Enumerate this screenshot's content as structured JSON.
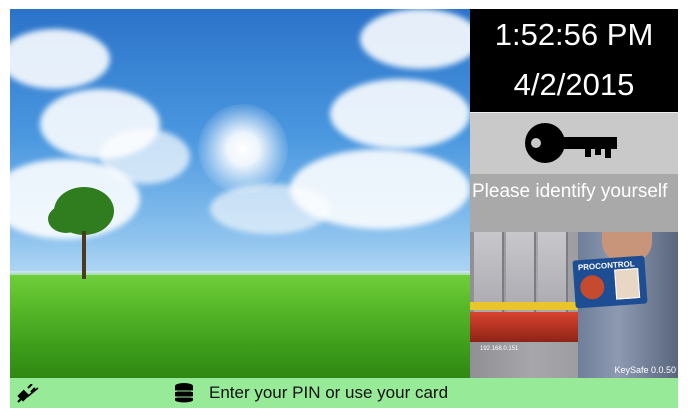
{
  "clock": {
    "time": "1:52:56 PM",
    "date": "4/2/2015"
  },
  "prompt": {
    "text": "Please identify yourself"
  },
  "photo": {
    "card_title": "PROCONTROL",
    "ip": "192.168.0.151",
    "version": "KeySafe 0.0.50"
  },
  "bottom": {
    "instruction": "Enter your PIN or use your card",
    "left_icon": "plug-icon",
    "instruction_icon": "database-icon"
  },
  "icons": {
    "key": "key-icon"
  },
  "colors": {
    "bottom_bar": "#97ea98",
    "clock_bg": "#000000",
    "key_panel": "#c9c9c9",
    "prompt_bg": "#a9a9a9"
  }
}
